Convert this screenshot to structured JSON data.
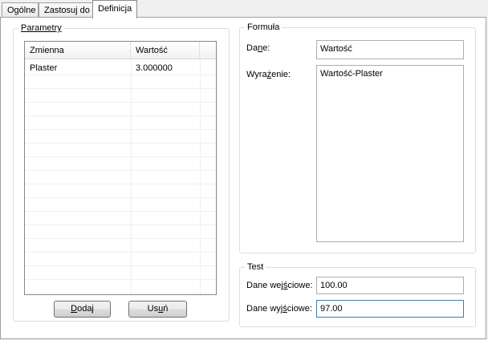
{
  "tabs": [
    {
      "label": "Ogólne"
    },
    {
      "label": "Zastosuj do"
    },
    {
      "label": "Definicja"
    }
  ],
  "parameters": {
    "title": "Parametry",
    "columns": [
      "Zmienna",
      "Wartość"
    ],
    "rows": [
      {
        "name": "Plaster",
        "value": "3.000000"
      }
    ],
    "add_label_pre": "",
    "add_label_key": "D",
    "add_label_post": "odaj",
    "remove_label_pre": "Us",
    "remove_label_key": "u",
    "remove_label_post": "ń"
  },
  "formula": {
    "title": "Formuła",
    "data_label_pre": "Da",
    "data_label_key": "n",
    "data_label_post": "e:",
    "data_value": "Wartość",
    "expression_label_pre": "Wyra",
    "expression_label_key": "ż",
    "expression_label_post": "enie:",
    "expression_value": "Wartość-Plaster"
  },
  "test": {
    "title": "Test",
    "input_label_pre": "Dane wej",
    "input_label_key": "ś",
    "input_label_post": "ciowe:",
    "input_value": "100.00",
    "output_label_pre": "Dane wyj",
    "output_label_key": "ś",
    "output_label_post": "ciowe:",
    "output_value": "97.00"
  }
}
